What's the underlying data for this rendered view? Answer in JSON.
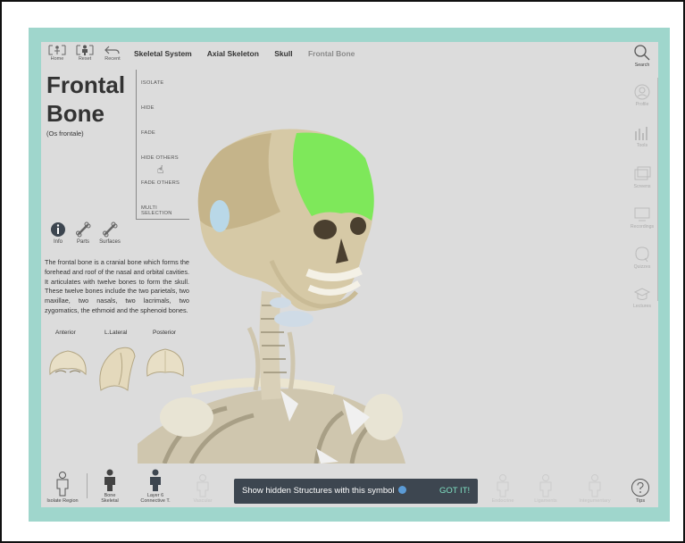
{
  "toolbar": {
    "home_label": "Home",
    "reset_label": "Reset",
    "recent_label": "Recent"
  },
  "breadcrumb": [
    "Skeletal System",
    "Axial Skeleton",
    "Skull",
    "Frontal Bone"
  ],
  "structure": {
    "title_line1": "Frontal",
    "title_line2": "Bone",
    "latin_name": "(Os frontale)"
  },
  "actions": [
    "ISOLATE",
    "HIDE",
    "FADE",
    "HIDE OTHERS",
    "FADE OTHERS",
    "MULTI SELECTION"
  ],
  "info_tabs": [
    "Info",
    "Parts",
    "Surfaces"
  ],
  "description": "The frontal bone is a cranial bone which forms the forehead and roof of the nasal and orbital cavities. It articulates with twelve bones to form the skull. These twelve bones include the two parietals, two maxillae, two nasals, two lacrimals, two zygomatics, the ethmoid and the sphenoid bones.",
  "views": [
    "Anterior",
    "L.Lateral",
    "Posterior"
  ],
  "right_sidebar": [
    "Search",
    "Profile",
    "Tools",
    "Screens",
    "Recordings",
    "Quizzes",
    "Lectures"
  ],
  "bottom_bar": {
    "isolate_region": "Isolate Region",
    "bone_line1": "Bone",
    "bone_line2": "Skeletal",
    "layer_line1": "Layer 6",
    "layer_line2": "Connective T.",
    "tips": "Tips",
    "faint_items": [
      "Vascular",
      "Endocrine",
      "Ligaments",
      "Integumentary"
    ]
  },
  "toast": {
    "message": "Show hidden Structures with this symbol",
    "action_label": "GOT IT!"
  },
  "colors": {
    "frame": "#9fd6cc",
    "highlight": "#7ee85a",
    "toast_bg": "#3d4650",
    "toast_action": "#7fe0c2"
  }
}
